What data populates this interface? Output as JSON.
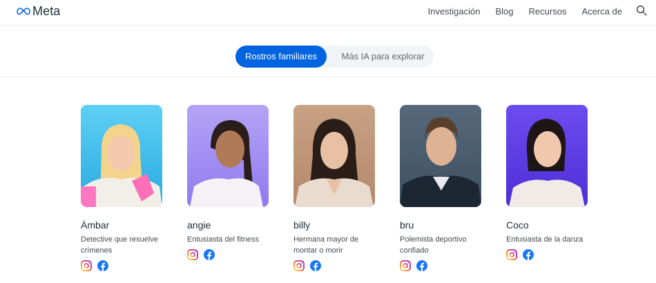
{
  "brand": {
    "name": "Meta",
    "logo_icon": "meta-infinity-logo",
    "accent": "#0064e0"
  },
  "nav": {
    "items": [
      "Investigación",
      "Blog",
      "Recursos",
      "Acerca de"
    ],
    "search_icon": "search-icon"
  },
  "tabs": {
    "active": "Rostros familiares",
    "inactive": "Más IA para explorar"
  },
  "characters": [
    {
      "name": "Ámbar",
      "description": "Detective que resuelve crímenes",
      "bg": "#38c0ef"
    },
    {
      "name": "angie",
      "description": "Entusiasta del fitness",
      "bg": "#a592f3"
    },
    {
      "name": "billy",
      "description": "Hermana mayor de montar o morir",
      "bg": "#c19777"
    },
    {
      "name": "bru",
      "description": "Polemista deportivo confiado",
      "bg": "#4b6072"
    },
    {
      "name": "Coco",
      "description": "Entusiasta de la danza",
      "bg": "#5d3ee6"
    }
  ],
  "social_icons": [
    "instagram-icon",
    "facebook-icon"
  ]
}
